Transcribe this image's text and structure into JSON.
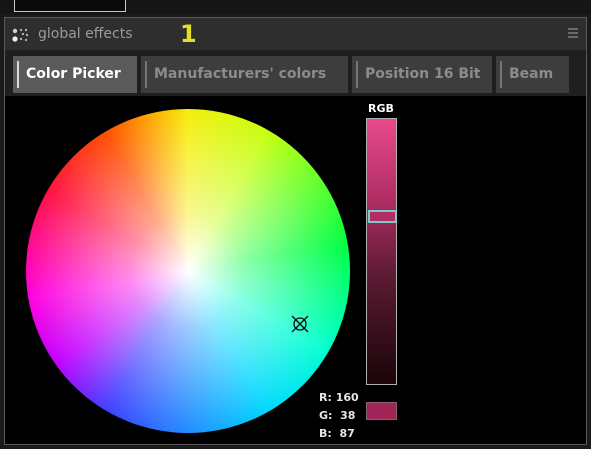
{
  "window": {
    "title": "global effects",
    "number_badge": "1",
    "accent_color": "#e6e020"
  },
  "tabs": [
    {
      "label": "Color Picker",
      "active": true
    },
    {
      "label": "Manufacturers' colors",
      "active": false
    },
    {
      "label": "Position 16 Bit",
      "active": false
    },
    {
      "label": "Beam",
      "active": false
    }
  ],
  "color_picker": {
    "slider_label": "RGB",
    "r_label": "R:",
    "r_value": "160",
    "g_label": "G:",
    "g_value": "38",
    "b_label": "B:",
    "b_value": "87",
    "selected_color": "#a02657",
    "slider_level": 0.36
  }
}
